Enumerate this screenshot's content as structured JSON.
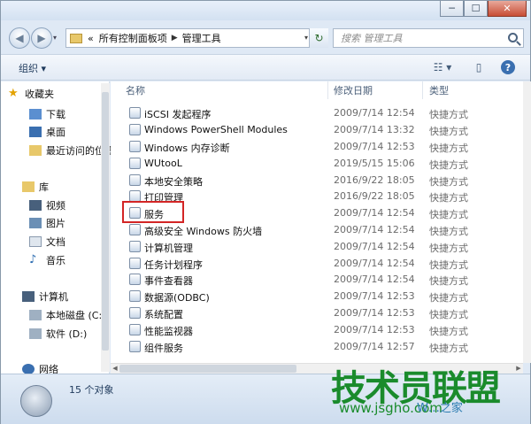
{
  "window": {
    "controls": {
      "minimize": "─",
      "maximize": "☐",
      "close": "✕"
    }
  },
  "address": {
    "back": "◀",
    "forward": "▶",
    "history": "▾",
    "overflow": "«",
    "crumbs": [
      "所有控制面板项",
      "管理工具"
    ],
    "separator": "▶",
    "refresh": "↻",
    "search_placeholder": "搜索 管理工具"
  },
  "toolbar": {
    "organize": "组织 ▾",
    "view": "☷ ▾",
    "preview": "▯",
    "help": "?"
  },
  "nav": {
    "favorites": {
      "title": "收藏夹",
      "items": [
        "下载",
        "桌面",
        "最近访问的位置"
      ]
    },
    "libraries": {
      "title": "库",
      "items": [
        "视频",
        "图片",
        "文档",
        "音乐"
      ]
    },
    "computer": {
      "title": "计算机",
      "items": [
        "本地磁盘 (C:)",
        "软件 (D:)"
      ]
    },
    "network": {
      "title": "网络"
    }
  },
  "columns": {
    "name": "名称",
    "date": "修改日期",
    "type": "类型"
  },
  "files": [
    {
      "name": "iSCSI 发起程序",
      "date": "2009/7/14 12:54",
      "type": "快捷方式"
    },
    {
      "name": "Windows PowerShell Modules",
      "date": "2009/7/14 13:32",
      "type": "快捷方式"
    },
    {
      "name": "Windows 内存诊断",
      "date": "2009/7/14 12:53",
      "type": "快捷方式"
    },
    {
      "name": "WUtooL",
      "date": "2019/5/15 15:06",
      "type": "快捷方式"
    },
    {
      "name": "本地安全策略",
      "date": "2016/9/22 18:05",
      "type": "快捷方式"
    },
    {
      "name": "打印管理",
      "date": "2016/9/22 18:05",
      "type": "快捷方式"
    },
    {
      "name": "服务",
      "date": "2009/7/14 12:54",
      "type": "快捷方式"
    },
    {
      "name": "高级安全 Windows 防火墙",
      "date": "2009/7/14 12:54",
      "type": "快捷方式"
    },
    {
      "name": "计算机管理",
      "date": "2009/7/14 12:54",
      "type": "快捷方式"
    },
    {
      "name": "任务计划程序",
      "date": "2009/7/14 12:54",
      "type": "快捷方式"
    },
    {
      "name": "事件查看器",
      "date": "2009/7/14 12:54",
      "type": "快捷方式"
    },
    {
      "name": "数据源(ODBC)",
      "date": "2009/7/14 12:53",
      "type": "快捷方式"
    },
    {
      "name": "系统配置",
      "date": "2009/7/14 12:53",
      "type": "快捷方式"
    },
    {
      "name": "性能监视器",
      "date": "2009/7/14 12:53",
      "type": "快捷方式"
    },
    {
      "name": "组件服务",
      "date": "2009/7/14 12:57",
      "type": "快捷方式"
    }
  ],
  "status": {
    "count": "15 个对象"
  },
  "watermark": {
    "brand": "技术员联盟",
    "url": "www.jsgho.com",
    "extra": "W…之家"
  },
  "colors": {
    "highlight": "#d32525",
    "watermark": "#1a8b2c"
  }
}
